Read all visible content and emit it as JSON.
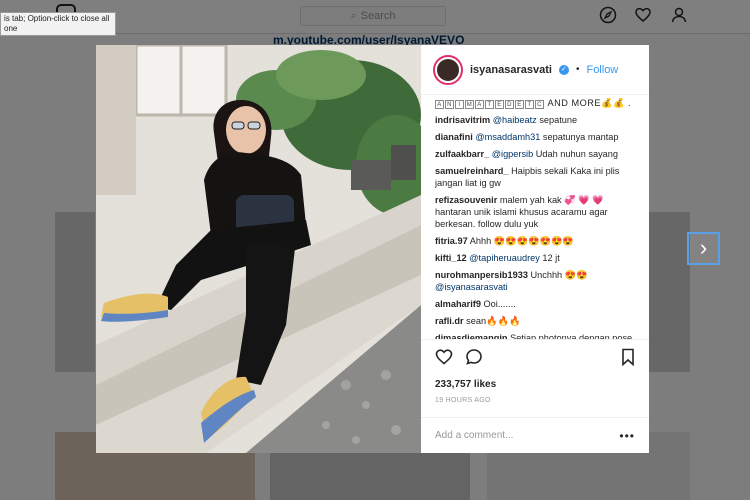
{
  "tooltip": {
    "line1": "is tab; Option-click to close all",
    "line2": "one"
  },
  "background": {
    "search_placeholder": "Search",
    "profile_url": "m.youtube.com/user/IsyanaVEVO",
    "nav_icons": [
      "compass-icon",
      "heart-icon",
      "person-icon"
    ]
  },
  "post": {
    "username": "isyanasarasvati",
    "follow_label": "Follow",
    "caption_tail_boxes": [
      "A",
      "N",
      "I",
      "M",
      "A",
      "T",
      "E",
      "D",
      "E",
      "T",
      "C"
    ],
    "caption_and_more": "AND MORE💰💰 .",
    "comments": [
      {
        "user": "indrisavitrim",
        "mention": "@haibeatz",
        "text": " sepatune"
      },
      {
        "user": "dianafini",
        "mention": "@msaddamh31",
        "text": " sepatunya mantap"
      },
      {
        "user": "zulfaakbarr_",
        "mention": "@igpersib",
        "text": " Udah nuhun sayang"
      },
      {
        "user": "samuelreinhard_",
        "mention": "",
        "text": " Haipbis sekali Kaka ini plis jangan liat ig gw"
      },
      {
        "user": "refizasouvenir",
        "mention": "",
        "text": " malem yah kak 💞 💗 💗 hantaran unik islami khusus acaramu agar berkesan. follow dulu yuk"
      },
      {
        "user": "fitria.97",
        "mention": "",
        "text": " Ahhh 😍😍😍😍😍😍😍"
      },
      {
        "user": "kifti_12",
        "mention": "@tapiheruaudrey",
        "text": " 12 jt"
      },
      {
        "user": "nurohmanpersib1933",
        "mention": "",
        "text": " Unchhh 😍😍 ",
        "mention2": "@isyanasarasvati"
      },
      {
        "user": "almaharif9",
        "mention": "",
        "text": " Ooi......."
      },
      {
        "user": "rafli.dr",
        "mention": "",
        "text": " sean🔥🔥🔥"
      },
      {
        "user": "dimasdjemangin",
        "mention": "",
        "text": " Setiap photonya dengan pose apapun tetep saja cantik w"
      }
    ],
    "likes": "233,757 likes",
    "time": "19 HOURS AGO",
    "comment_placeholder": "Add a comment...",
    "more_label": "•••"
  },
  "colors": {
    "accent": "#3897f0",
    "verified": "#3897f0",
    "story_ring": "#e1306c"
  }
}
